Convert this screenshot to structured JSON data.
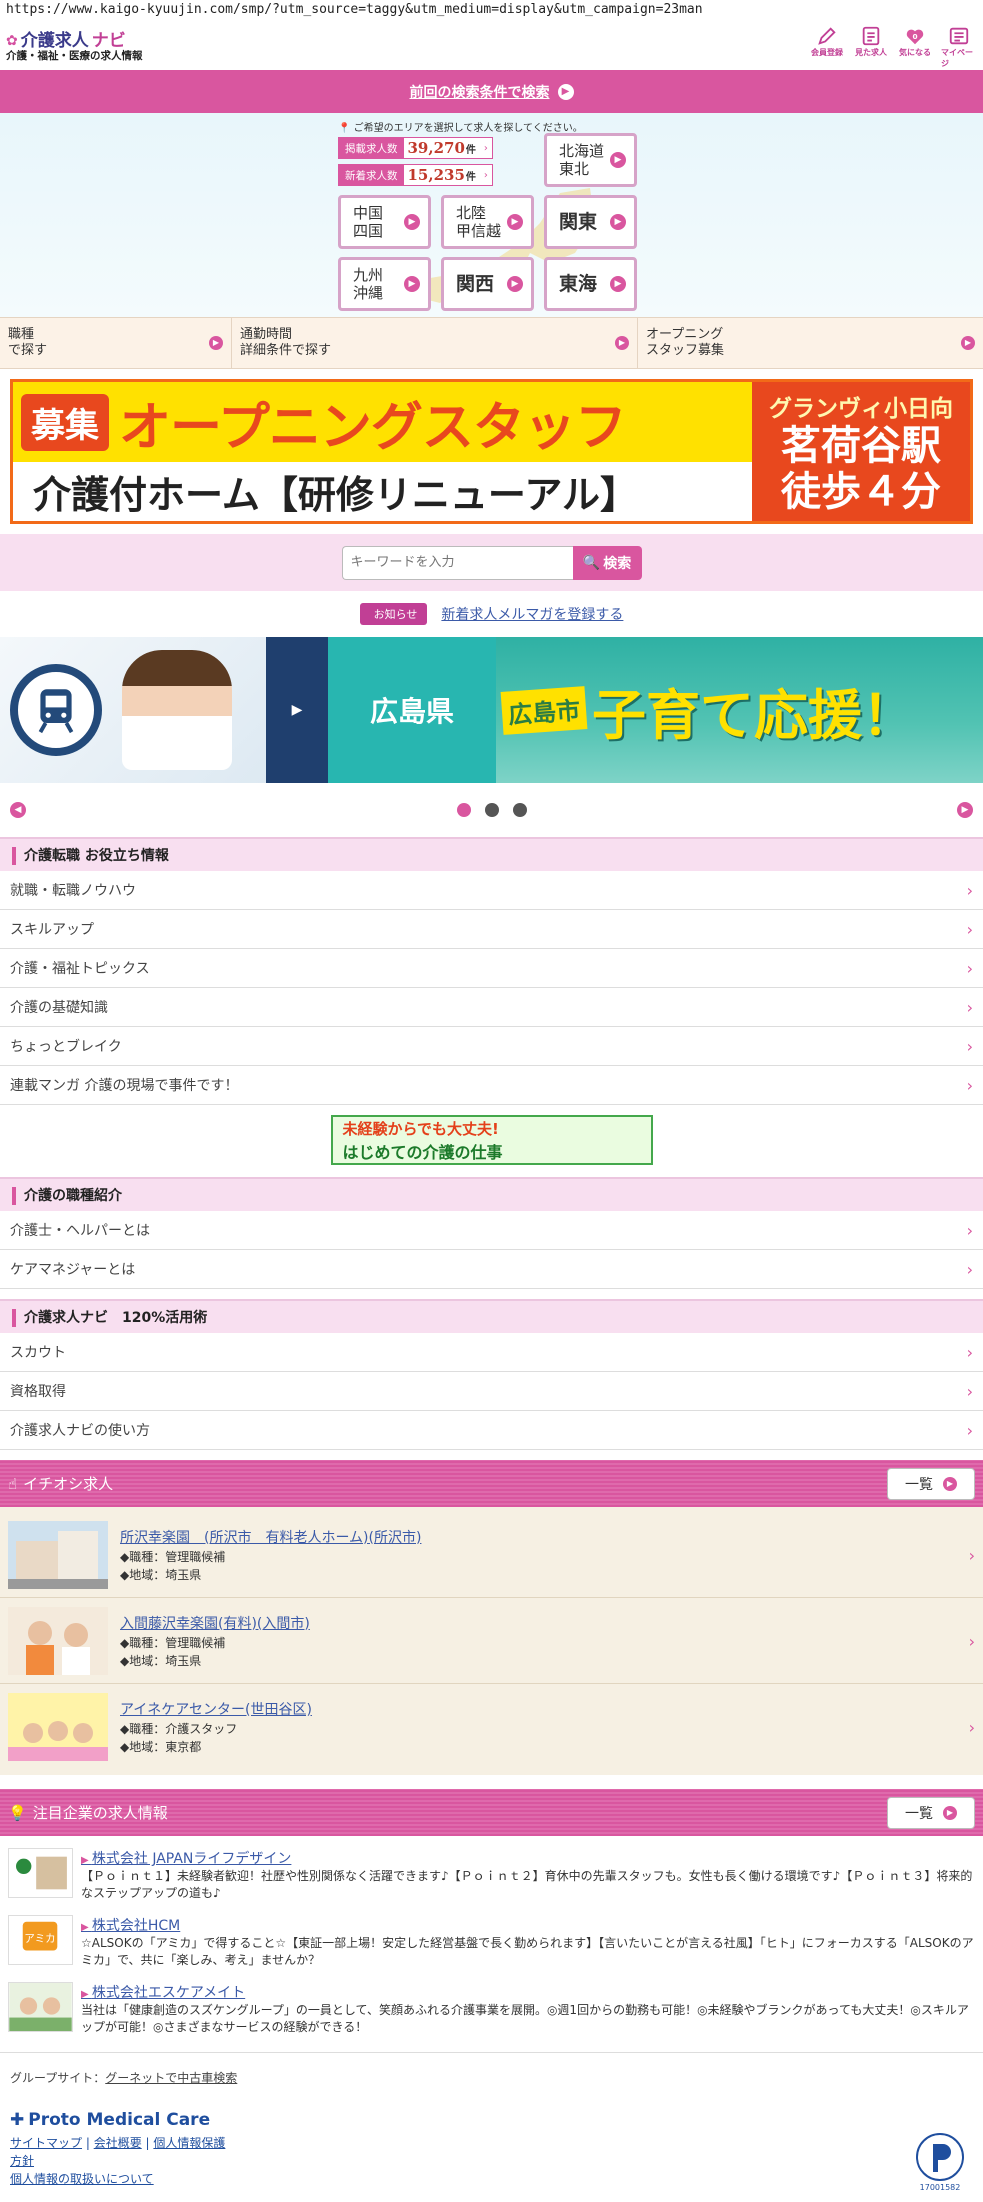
{
  "browser": {
    "url": "https://www.kaigo-kyuujin.com/smp/?utm_source=taggy&utm_medium=display&utm_campaign=23man"
  },
  "header": {
    "logo_part1": "介護求人",
    "logo_part2": "ナビ",
    "logo_sub": "介護・福祉・医療の求人情報",
    "icons": [
      {
        "label": "会員登録",
        "icon": "pencil-icon"
      },
      {
        "label": "見た求人",
        "icon": "history-icon"
      },
      {
        "label": "気になる",
        "icon": "heart-icon",
        "badge": "0"
      },
      {
        "label": "マイページ",
        "icon": "mypage-icon"
      }
    ]
  },
  "top_search": {
    "label": "前回の検索条件で検索"
  },
  "area": {
    "note": "ご希望のエリアを選択して求人を探してください。",
    "counts": [
      {
        "label": "掲載求人数",
        "value": "39,270",
        "unit": "件"
      },
      {
        "label": "新着求人数",
        "value": "15,235",
        "unit": "件"
      }
    ],
    "regions": [
      {
        "label": "北海道\n東北",
        "l1": "北海道",
        "l2": "東北"
      },
      {
        "label": "中国四国",
        "l1": "中国",
        "l2": "四国"
      },
      {
        "label": "北陸甲信越",
        "l1": "北陸",
        "l2": "甲信越"
      },
      {
        "label": "関東"
      },
      {
        "label": "九州沖縄",
        "l1": "九州",
        "l2": "沖縄"
      },
      {
        "label": "関西"
      },
      {
        "label": "東海"
      }
    ]
  },
  "quicklinks": [
    {
      "l1": "職種",
      "l2": "で探す"
    },
    {
      "l1": "通勤時間",
      "l2": "詳細条件で探す"
    },
    {
      "l1": "オープニング",
      "l2": "スタッフ募集"
    }
  ],
  "banner_opening": {
    "badge": "募集",
    "title": "オープニングスタッフ",
    "subtitle": "介護付ホーム【研修リニューアル】",
    "facility": "グランヴィ小日向",
    "station": "茗荷谷駅",
    "walk": "徒歩４分"
  },
  "search": {
    "placeholder": "キーワードを入力",
    "button": "検索"
  },
  "notice": {
    "badge": "お知らせ",
    "link": "新着求人メルマガを登録する"
  },
  "carousel": {
    "prefecture": "広島県",
    "city": "広島市",
    "slogan": "子育て応援！"
  },
  "sections": {
    "tips": {
      "title": "介護転職 お役立ち情報",
      "items": [
        "就職・転職ノウハウ",
        "スキルアップ",
        "介護・福祉トピックス",
        "介護の基礎知識",
        "ちょっとブレイク",
        "連載マンガ 介護の現場で事件です！"
      ]
    },
    "mikeiken": {
      "line1": "未経験からでも大丈夫!",
      "line2": "はじめての介護の仕事"
    },
    "jobtypes": {
      "title": "介護の職種紹介",
      "items": [
        "介護士・ヘルパーとは",
        "ケアマネジャーとは"
      ]
    },
    "usage": {
      "title": "介護求人ナビ　120%活用術",
      "items": [
        "スカウト",
        "資格取得",
        "介護求人ナビの使い方"
      ]
    }
  },
  "pickup": {
    "title": "イチオシ求人",
    "more": "一覧",
    "items": [
      {
        "title": "所沢幸楽園　(所沢市　有料老人ホーム)(所沢市)",
        "job": "◆職種：管理職候補",
        "area": "◆地域：埼玉県"
      },
      {
        "title": "入間藤沢幸楽園(有料)(入間市)",
        "job": "◆職種：管理職候補",
        "area": "◆地域：埼玉県"
      },
      {
        "title": "アイネケアセンター(世田谷区)",
        "job": "◆職種：介護スタッフ",
        "area": "◆地域：東京都"
      }
    ]
  },
  "corp": {
    "title": "注目企業の求人情報",
    "more": "一覧",
    "items": [
      {
        "name": "株式会社 JAPANライフデザイン",
        "desc": "【Ｐｏｉｎｔ１】未経験者歓迎！社歴や性別関係なく活躍できます♪【Ｐｏｉｎｔ２】育休中の先輩スタッフも。女性も長く働ける環境です♪【Ｐｏｉｎｔ３】将来的なステップアップの道も♪"
      },
      {
        "name": "株式会社HCM",
        "desc": "☆ALSOKの「アミカ」で得すること☆【東証一部上場！安定した経営基盤で長く勤められます】【言いたいことが言える社風】「ヒト」にフォーカスする「ALSOKのアミカ」で、共に「楽しみ、考え」ませんか？"
      },
      {
        "name": "株式会社エスケアメイト",
        "desc": "当社は「健康創造のスズケングループ」の一員として、笑顔あふれる介護事業を展開。◎週1回からの勤務も可能！◎未経験やブランクがあっても大丈夫！◎スキルアップが可能！◎さまざまなサービスの経験ができる！"
      }
    ]
  },
  "footer": {
    "group_label": "グループサイト：",
    "group_link": "グーネットで中古車検索",
    "brand": "Proto Medical Care",
    "links": [
      "サイトマップ",
      "会社概要",
      "個人情報保護"
    ],
    "link4": "方針",
    "link5": "個人情報の取扱いについて",
    "pmark_no": "17001582"
  }
}
